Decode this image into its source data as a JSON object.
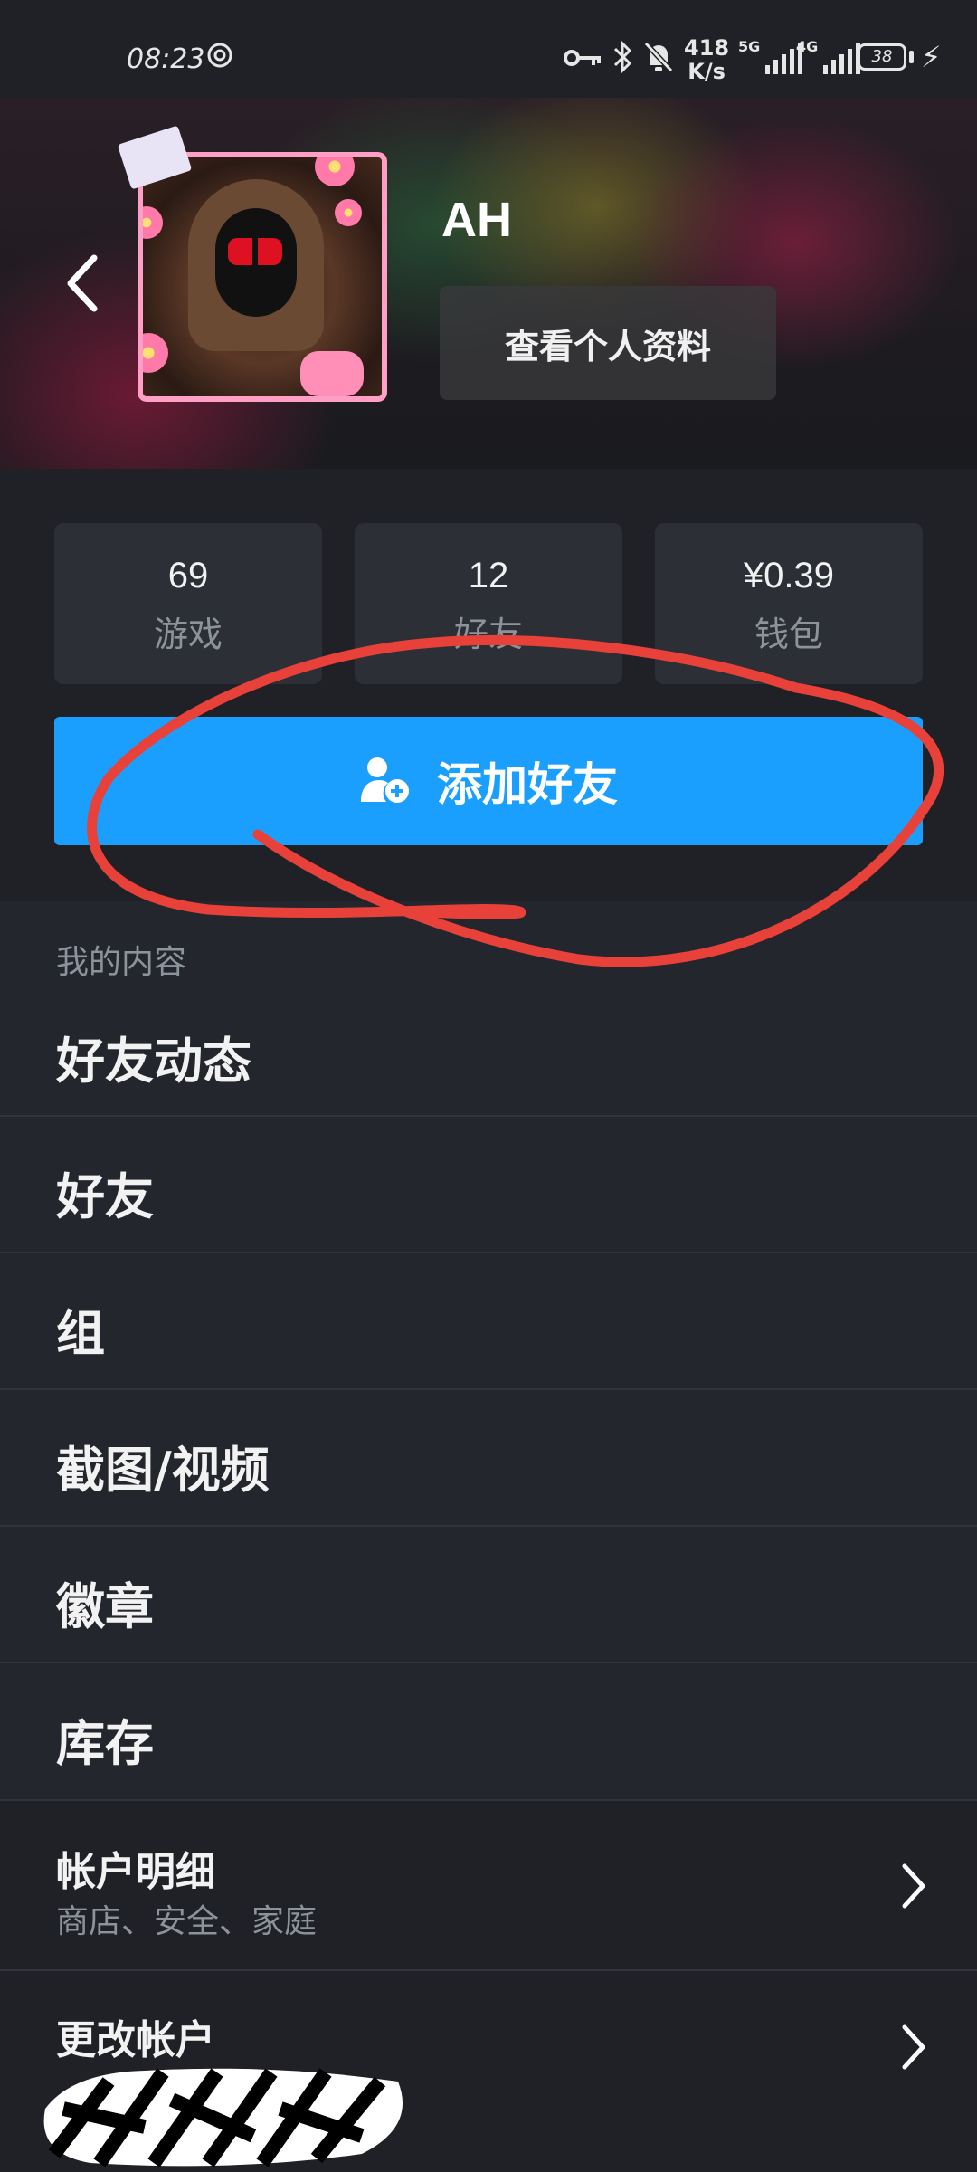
{
  "status_bar": {
    "time": "08:23",
    "net_speed_value": "418",
    "net_speed_unit": "K/s",
    "sim1_label": "5G",
    "sim2_label": "4G",
    "battery": "38",
    "icons": [
      "sync-icon",
      "key-icon",
      "bluetooth-icon",
      "mute-icon",
      "signal-icon",
      "battery-icon",
      "charging-icon"
    ]
  },
  "header": {
    "back_icon": "chevron-left-icon",
    "username": "AH",
    "view_profile_label": "查看个人资料"
  },
  "stats": [
    {
      "value": "69",
      "label": "游戏"
    },
    {
      "value": "12",
      "label": "好友"
    },
    {
      "value": "¥0.39",
      "label": "钱包"
    }
  ],
  "add_friend": {
    "label": "添加好友",
    "icon": "add-user-icon"
  },
  "section_title": "我的内容",
  "menu": [
    {
      "label": "好友动态"
    },
    {
      "label": "好友"
    },
    {
      "label": "组"
    },
    {
      "label": "截图/视频"
    },
    {
      "label": "徽章"
    },
    {
      "label": "库存"
    }
  ],
  "account_rows": [
    {
      "label": "帐户明细",
      "sub": "商店、安全、家庭"
    },
    {
      "label": "更改帐户",
      "sub": ""
    }
  ],
  "colors": {
    "accent": "#1a9fff",
    "background": "#23262d",
    "annotation": "#e8413a"
  }
}
